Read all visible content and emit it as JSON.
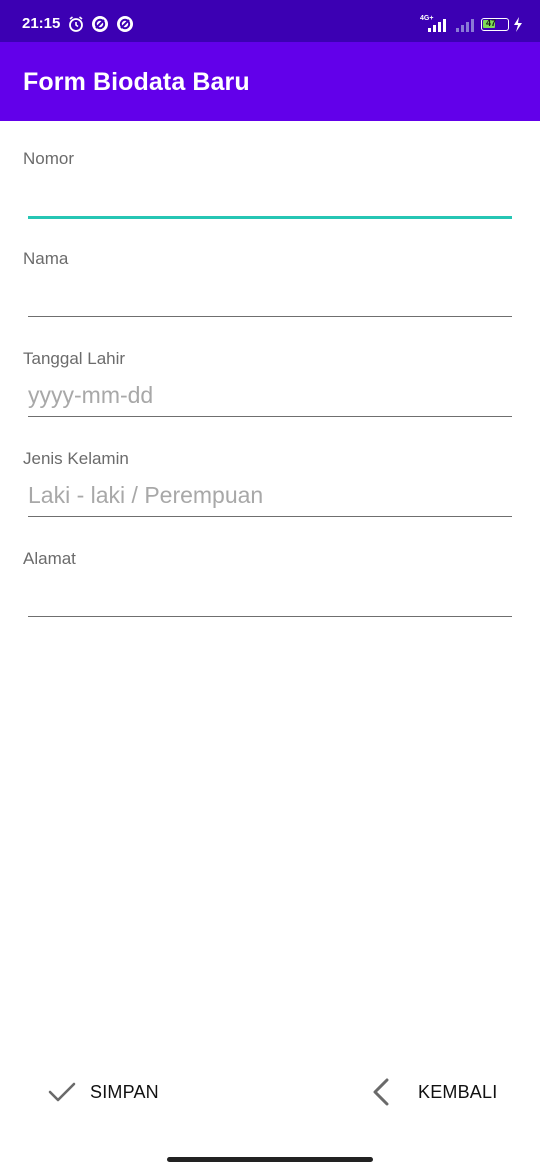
{
  "status_bar": {
    "time": "21:15",
    "network_label": "4G+",
    "battery": "47",
    "icons": [
      "alarm-icon",
      "sync-icon",
      "sync-icon",
      "signal-icon",
      "signal-icon",
      "battery-icon",
      "charging-icon"
    ]
  },
  "app_bar": {
    "title": "Form Biodata Baru"
  },
  "form": {
    "fields": [
      {
        "label": "Nomor",
        "value": "",
        "placeholder": ""
      },
      {
        "label": "Nama",
        "value": "",
        "placeholder": ""
      },
      {
        "label": "Tanggal Lahir",
        "value": "",
        "placeholder": "yyyy-mm-dd"
      },
      {
        "label": "Jenis Kelamin",
        "value": "",
        "placeholder": "Laki - laki / Perempuan"
      },
      {
        "label": "Alamat",
        "value": "",
        "placeholder": ""
      }
    ]
  },
  "actions": {
    "save_label": "SIMPAN",
    "back_label": "KEMBALI"
  },
  "colors": {
    "status_bar": "#3c00b3",
    "app_bar": "#6200ea",
    "focus_underline": "#26c6b4"
  }
}
